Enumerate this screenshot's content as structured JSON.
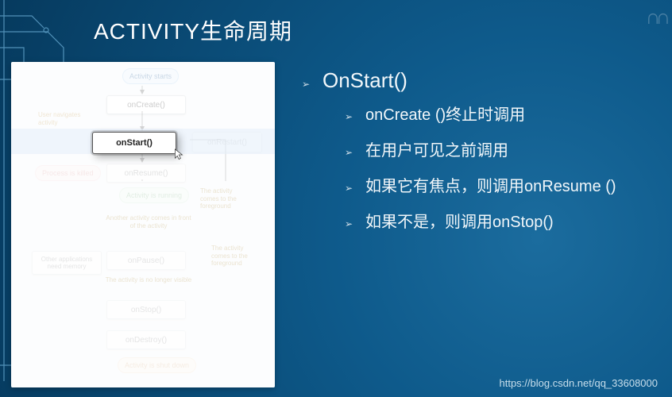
{
  "title": "ACTIVITY生命周期",
  "diagram": {
    "launch": "Activity starts",
    "onCreate": "onCreate()",
    "userNav": "User navigates activity",
    "onStart": "onStart()",
    "onRestart": "onRestart()",
    "onResume": "onResume()",
    "running": "Activity is running",
    "note_fg": "The activity comes to the foreground",
    "anotherFront": "Another activity comes in front of the activity",
    "noteFg2": "The activity comes to the foreground",
    "otherApps": "Other applications need memory",
    "onPause": "onPause()",
    "noLonger": "The activity is no longer visible",
    "onStop": "onStop()",
    "onDestroy": "onDestroy()",
    "processKilled": "Process is killed",
    "shutdown": "Activity is shut down"
  },
  "bullets": {
    "h": "OnStart()",
    "items": [
      "onCreate ()终止时调用",
      "在用户可见之前调用",
      "如果它有焦点，则调用onResume ()",
      "如果不是，则调用onStop()"
    ]
  },
  "footer_url": "https://blog.csdn.net/qq_33608000"
}
